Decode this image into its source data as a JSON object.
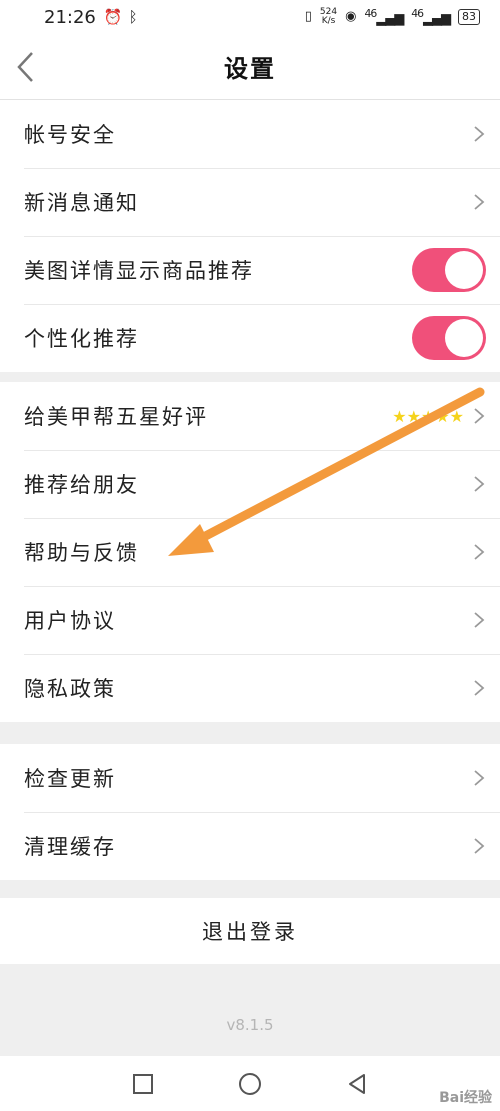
{
  "status_bar": {
    "time": "21:26",
    "net_speed_value": "524",
    "net_speed_unit": "K/s",
    "signal1": "46",
    "signal2": "46",
    "battery": "83"
  },
  "header": {
    "title": "设置"
  },
  "group1": [
    {
      "label": "帐号安全",
      "control": "chevron"
    },
    {
      "label": "新消息通知",
      "control": "chevron"
    },
    {
      "label": "美图详情显示商品推荐",
      "control": "toggle",
      "on": true
    },
    {
      "label": "个性化推荐",
      "control": "toggle",
      "on": true
    }
  ],
  "group2": [
    {
      "label": "给美甲帮五星好评",
      "control": "stars",
      "stars": "★★★★★"
    },
    {
      "label": "推荐给朋友",
      "control": "chevron"
    },
    {
      "label": "帮助与反馈",
      "control": "chevron"
    },
    {
      "label": "用户协议",
      "control": "chevron"
    },
    {
      "label": "隐私政策",
      "control": "chevron"
    }
  ],
  "group3": [
    {
      "label": "检查更新",
      "control": "chevron"
    },
    {
      "label": "清理缓存",
      "control": "chevron"
    }
  ],
  "logout_label": "退出登录",
  "version": "v8.1.5",
  "watermark": "Bai经验",
  "colors": {
    "toggle_on": "#f0507a",
    "star": "#f5d31c",
    "annotation_arrow": "#f39a3c"
  }
}
